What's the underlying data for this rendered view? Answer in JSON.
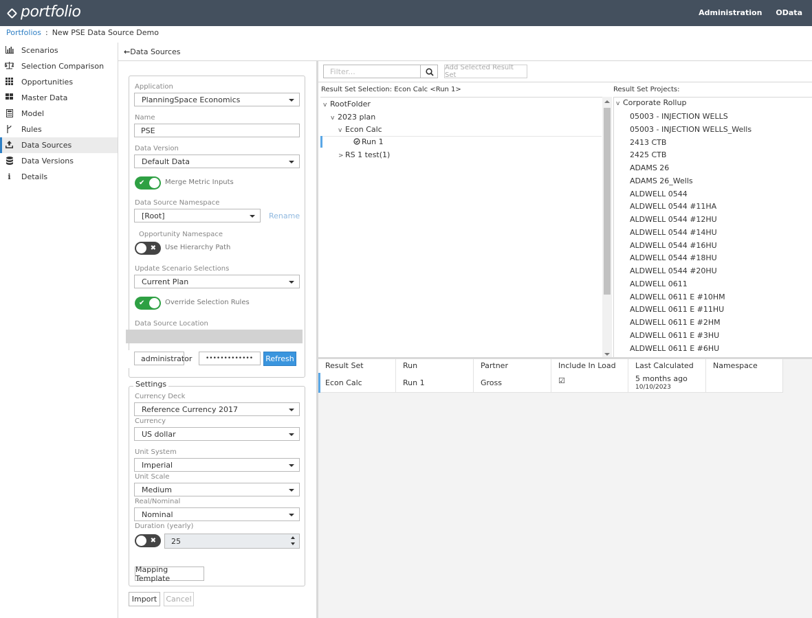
{
  "header": {
    "logo_text": "portfolio",
    "nav": [
      "Administration",
      "OData"
    ]
  },
  "breadcrumb": {
    "root": "Portfolios",
    "separator": ":",
    "current": "New PSE Data Source Demo"
  },
  "sidebar": {
    "items": [
      {
        "label": "Scenarios",
        "icon": "bar-chart-icon"
      },
      {
        "label": "Selection Comparison",
        "icon": "scale-icon"
      },
      {
        "label": "Opportunities",
        "icon": "grid-icon"
      },
      {
        "label": "Master Data",
        "icon": "tiles-icon"
      },
      {
        "label": "Model",
        "icon": "calculator-icon"
      },
      {
        "label": "Rules",
        "icon": "branch-icon"
      },
      {
        "label": "Data Sources",
        "icon": "upload-icon",
        "active": true
      },
      {
        "label": "Data Versions",
        "icon": "database-icon"
      },
      {
        "label": "Details",
        "icon": "info-icon"
      }
    ]
  },
  "content": {
    "back_label": "Data Sources"
  },
  "form": {
    "application_label": "Application",
    "application_value": "PlanningSpace Economics",
    "name_label": "Name",
    "name_value": "PSE",
    "data_version_label": "Data Version",
    "data_version_value": "Default Data",
    "merge_metric_label": "Merge Metric Inputs",
    "namespace_label": "Data Source Namespace",
    "namespace_value": "[Root]",
    "rename_label": "Rename",
    "opportunity_namespace_label": "Opportunity Namespace",
    "hierarchy_label": "Use Hierarchy Path",
    "update_scenario_label": "Update Scenario Selections",
    "update_scenario_value": "Current Plan",
    "override_label": "Override Selection Rules",
    "location_label": "Data Source Location",
    "username_value": "administrator",
    "password_value": "•••••••••••••",
    "refresh_label": "Refresh",
    "settings_legend": "Settings",
    "currency_deck_label": "Currency Deck",
    "currency_deck_value": "Reference Currency 2017",
    "currency_label": "Currency",
    "currency_value": "US dollar",
    "unit_system_label": "Unit System",
    "unit_system_value": "Imperial",
    "unit_scale_label": "Unit Scale",
    "unit_scale_value": "Medium",
    "real_nominal_label": "Real/Nominal",
    "real_nominal_value": "Nominal",
    "duration_label": "Duration (yearly)",
    "duration_value": "25",
    "mapping_label": "Mapping Template",
    "import_label": "Import",
    "cancel_label": "Cancel"
  },
  "toolbar": {
    "filter_placeholder": "Filter...",
    "add_label": "Add Selected Result Set"
  },
  "result_selection": {
    "title": "Result Set Selection: Econ Calc <Run 1>",
    "tree": [
      {
        "label": "RootFolder",
        "chev": "v"
      },
      {
        "label": "2023 plan",
        "chev": "v"
      },
      {
        "label": "Econ Calc",
        "chev": "v"
      },
      {
        "label": "Run 1",
        "chev": ""
      },
      {
        "label": "RS 1 test(1)",
        "chev": ">"
      }
    ]
  },
  "projects": {
    "title": "Result Set Projects:",
    "root": "Corporate Rollup",
    "items": [
      "05003 - INJECTION WELLS",
      "05003 - INJECTION WELLS_Wells",
      "2413 CTB",
      "2425 CTB",
      "ADAMS 26",
      "ADAMS 26_Wells",
      "ALDWELL 0544",
      "ALDWELL 0544 #11HA",
      "ALDWELL 0544 #12HU",
      "ALDWELL 0544 #14HU",
      "ALDWELL 0544 #16HU",
      "ALDWELL 0544 #18HU",
      "ALDWELL 0544 #20HU",
      "ALDWELL 0611",
      "ALDWELL 0611 E #10HM",
      "ALDWELL 0611 E #11HU",
      "ALDWELL 0611 E #2HM",
      "ALDWELL 0611 E #3HU",
      "ALDWELL 0611 E #6HU"
    ]
  },
  "grid": {
    "columns": [
      "Result Set",
      "Run",
      "Partner",
      "Include In Load",
      "Last Calculated",
      "Namespace"
    ],
    "rows": [
      {
        "result_set": "Econ Calc",
        "run": "Run 1",
        "partner": "Gross",
        "include": "☑",
        "last_calc": "5 months ago",
        "last_calc_date": "10/10/2023",
        "namespace": ""
      }
    ]
  },
  "colors": {
    "header_bg": "#44505e",
    "accent": "#2f7fc4",
    "toggle_on": "#2ea043",
    "primary_button": "#3a95de"
  }
}
